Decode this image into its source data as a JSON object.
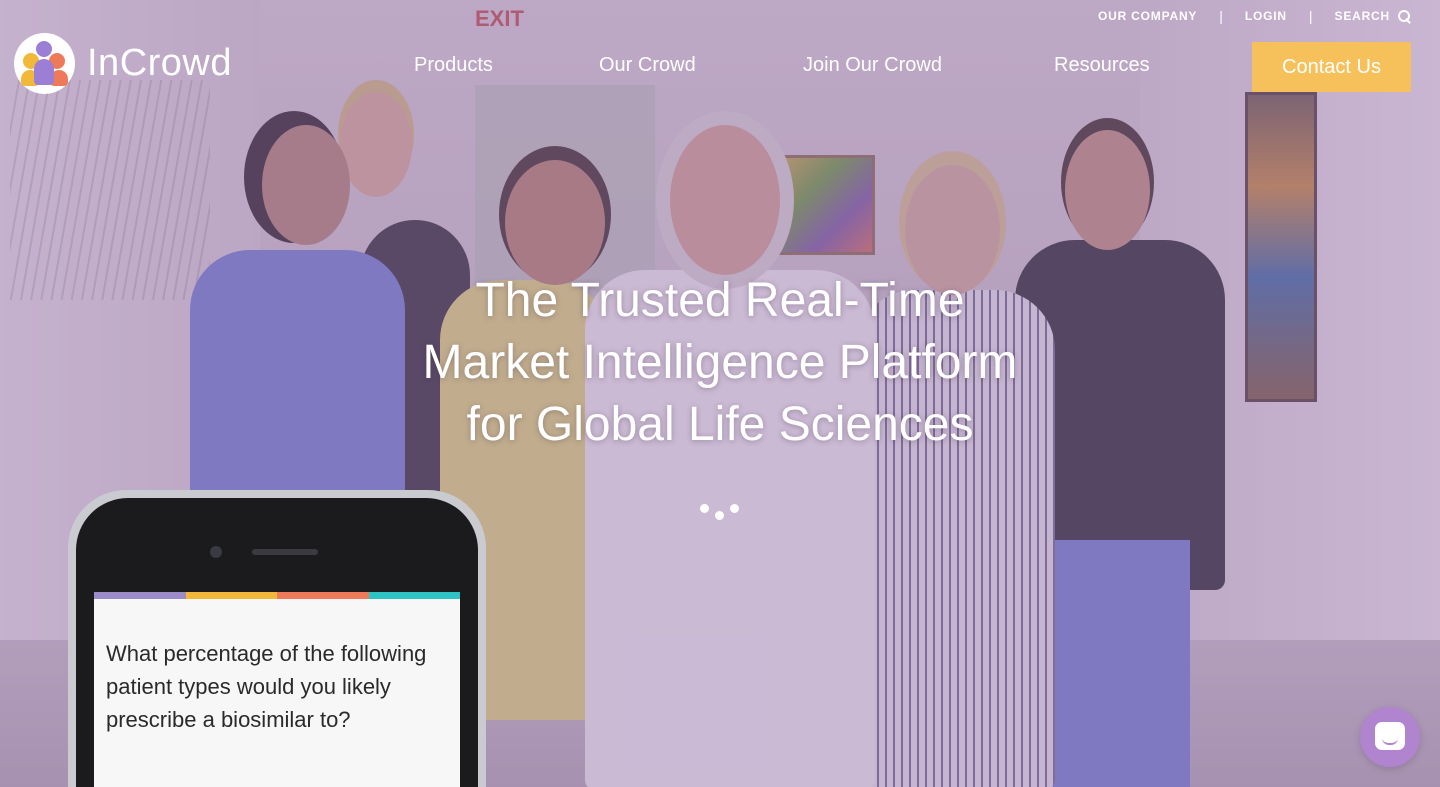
{
  "utility_nav": {
    "our_company": "OUR COMPANY",
    "login": "LOGIN",
    "search": "SEARCH",
    "separator": "|"
  },
  "logo": {
    "text": "InCrowd"
  },
  "main_nav": {
    "items": [
      {
        "label": "Products"
      },
      {
        "label": "Our Crowd"
      },
      {
        "label": "Join Our Crowd"
      },
      {
        "label": "Resources"
      }
    ],
    "contact_label": "Contact Us"
  },
  "hero": {
    "exit_sign": "EXIT",
    "headline_lines": [
      "The Trusted Real-Time",
      "Market Intelligence Platform",
      "for Global Life Sciences"
    ]
  },
  "phone": {
    "question": "What percentage of the following patient types would you likely prescribe a biosimilar to?",
    "bar_colors": [
      "#9b8cc7",
      "#f2b83a",
      "#ef7a5a",
      "#2ec4c4"
    ]
  },
  "colors": {
    "accent": "#f6c15a",
    "tint": "#9673af",
    "chat": "#b084cf"
  },
  "icons": {
    "search": "search-icon",
    "chat": "chat-icon",
    "logo": "incrowd-logo-icon"
  }
}
